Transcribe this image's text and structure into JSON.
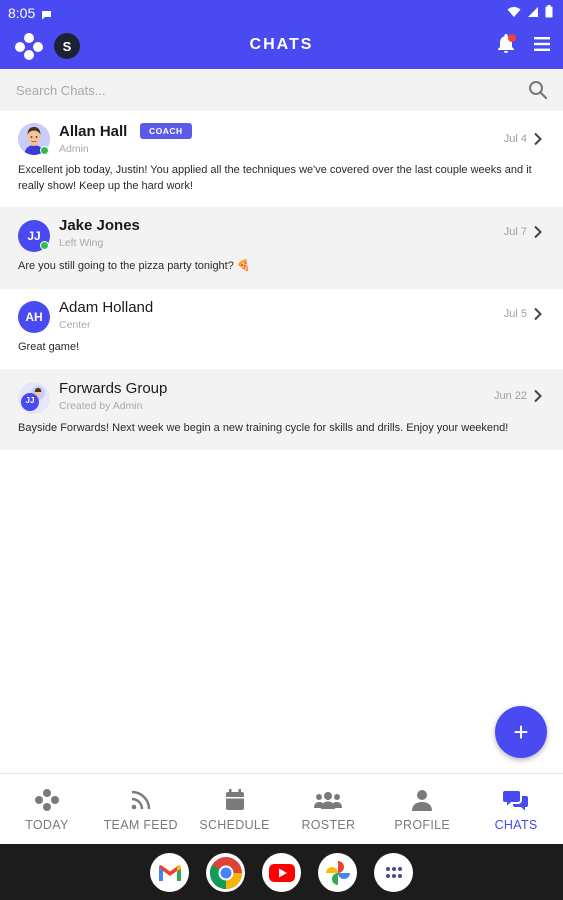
{
  "status_bar": {
    "time": "8:05"
  },
  "header": {
    "title": "CHATS",
    "user_initial": "S"
  },
  "search": {
    "placeholder": "Search Chats..."
  },
  "chats": [
    {
      "name": "Allan Hall",
      "badge": "COACH",
      "subtitle": "Admin",
      "date": "Jul 4",
      "message": "Excellent job today, Justin! You applied all the techniques we've covered over the last couple weeks and it really show! Keep up the hard work!",
      "online": true
    },
    {
      "name": "Jake Jones",
      "initials": "JJ",
      "subtitle": "Left Wing",
      "date": "Jul 7",
      "message": "Are you still going to the pizza party tonight? 🍕",
      "online": true
    },
    {
      "name": "Adam Holland",
      "initials": "AH",
      "subtitle": "Center",
      "date": "Jul 5",
      "message": "Great game!",
      "online": false
    },
    {
      "name": "Forwards Group",
      "initials": "JJ",
      "subtitle": "Created by Admin",
      "date": "Jun 22",
      "message": "Bayside Forwards! Next week we begin a new training cycle for skills and drills. Enjoy your weekend!",
      "online": false
    }
  ],
  "fab": {
    "label": "+"
  },
  "bottom_nav": {
    "items": [
      {
        "label": "TODAY",
        "icon": "today-icon"
      },
      {
        "label": "TEAM FEED",
        "icon": "feed-icon"
      },
      {
        "label": "SCHEDULE",
        "icon": "calendar-icon"
      },
      {
        "label": "ROSTER",
        "icon": "roster-icon"
      },
      {
        "label": "PROFILE",
        "icon": "profile-icon"
      },
      {
        "label": "CHATS",
        "icon": "chats-icon"
      }
    ],
    "active": "CHATS"
  },
  "dock": {
    "apps": [
      "Gmail",
      "Chrome",
      "YouTube",
      "Photos",
      "Apps"
    ]
  },
  "colors": {
    "brand": "#4a4af2",
    "badge": "#5b5be8",
    "online": "#2fbf4a",
    "alt_row": "#f3f3f3"
  }
}
